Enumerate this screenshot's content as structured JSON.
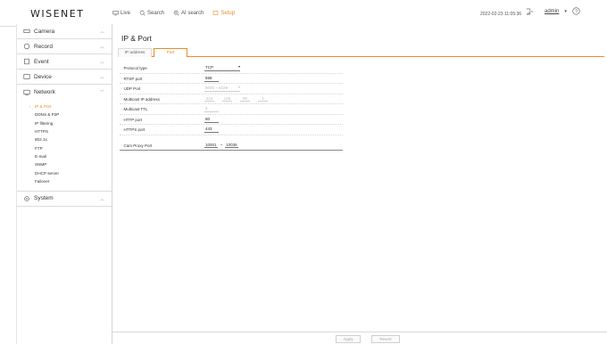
{
  "header": {
    "logo": "WISENET",
    "nav": [
      {
        "label": "Live",
        "icon": "monitor-icon"
      },
      {
        "label": "Search",
        "icon": "search-icon"
      },
      {
        "label": "AI search",
        "icon": "ai-search-icon"
      },
      {
        "label": "Setup",
        "icon": "setup-icon"
      }
    ],
    "datetime": "2022-02-23 11:05:36",
    "user": "admin"
  },
  "sidebar": {
    "items": [
      {
        "label": "Camera",
        "icon": "camera-icon"
      },
      {
        "label": "Record",
        "icon": "record-icon"
      },
      {
        "label": "Event",
        "icon": "event-icon"
      },
      {
        "label": "Device",
        "icon": "device-icon"
      },
      {
        "label": "Network",
        "icon": "network-icon"
      }
    ],
    "network_sub": [
      "IP & Port",
      "DDNS & P2P",
      "IP filtering",
      "HTTPS",
      "802.1x",
      "FTP",
      "E-mail",
      "SNMP",
      "DHCP server",
      "Failover"
    ],
    "system": {
      "label": "System",
      "icon": "gear-icon"
    }
  },
  "main": {
    "title": "IP & Port",
    "tabs": [
      "IP address",
      "Port"
    ],
    "fields": {
      "protocol_type": {
        "label": "Protocol type",
        "value": "TCP"
      },
      "rtsp_port": {
        "label": "RTSP port",
        "value": "558"
      },
      "udp_port": {
        "label": "UDP Port",
        "value": "8000 ~ 8159"
      },
      "multicast_ip": {
        "label": "Multicast IP address",
        "segs": [
          "224",
          "126",
          "00",
          "1"
        ]
      },
      "multicast_ttl": {
        "label": "Multicast TTL",
        "value": "5"
      },
      "http_port": {
        "label": "HTTP port",
        "value": "80"
      },
      "https_port": {
        "label": "HTTPS port",
        "value": "443"
      },
      "cam_proxy": {
        "label": "Cam Proxy Port",
        "from": "10001",
        "sep": "~",
        "to": "10036"
      }
    },
    "buttons": {
      "apply": "Apply",
      "revert": "Revert"
    }
  }
}
